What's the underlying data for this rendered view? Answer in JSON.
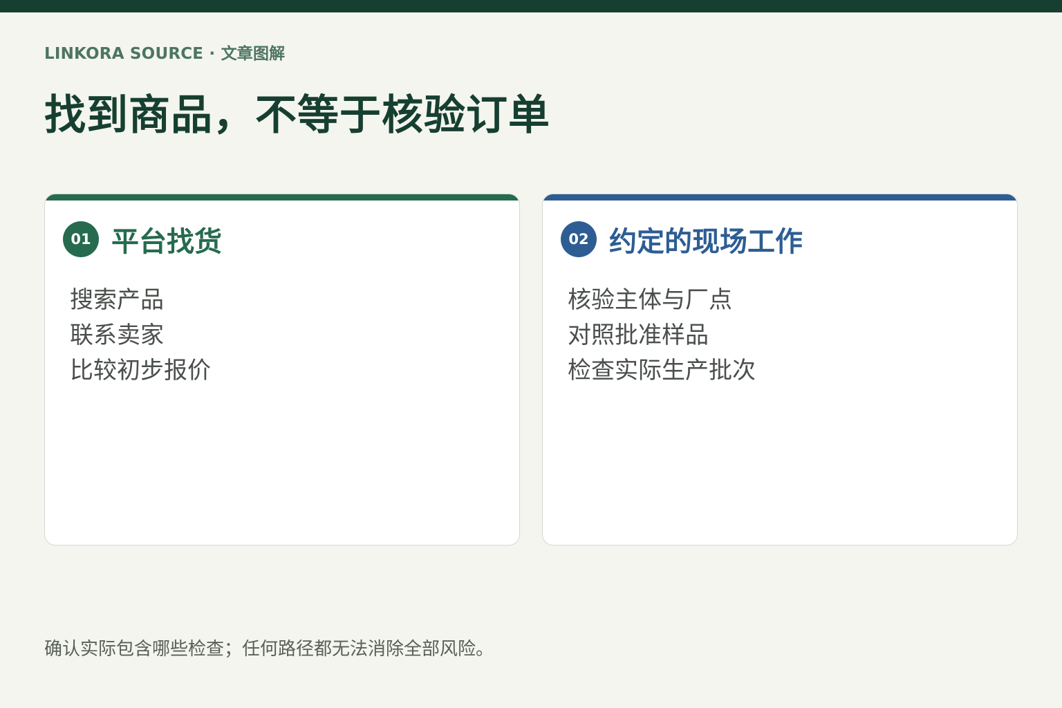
{
  "header": {
    "eyebrow": "LINKORA SOURCE · 文章图解",
    "title": "找到商品，不等于核验订单"
  },
  "cards": [
    {
      "number": "01",
      "title": "平台找货",
      "items": [
        "搜索产品",
        "联系卖家",
        "比较初步报价"
      ]
    },
    {
      "number": "02",
      "title": "约定的现场工作",
      "items": [
        "核验主体与厂点",
        "对照批准样品",
        "检查实际生产批次"
      ]
    }
  ],
  "footnote": "确认实际包含哪些检查；任何路径都无法消除全部风险。",
  "colors": {
    "background": "#f4f5ef",
    "top_bar": "#163f31",
    "title": "#163f31",
    "card1_accent": "#266b4f",
    "card2_accent": "#2d5d93"
  }
}
